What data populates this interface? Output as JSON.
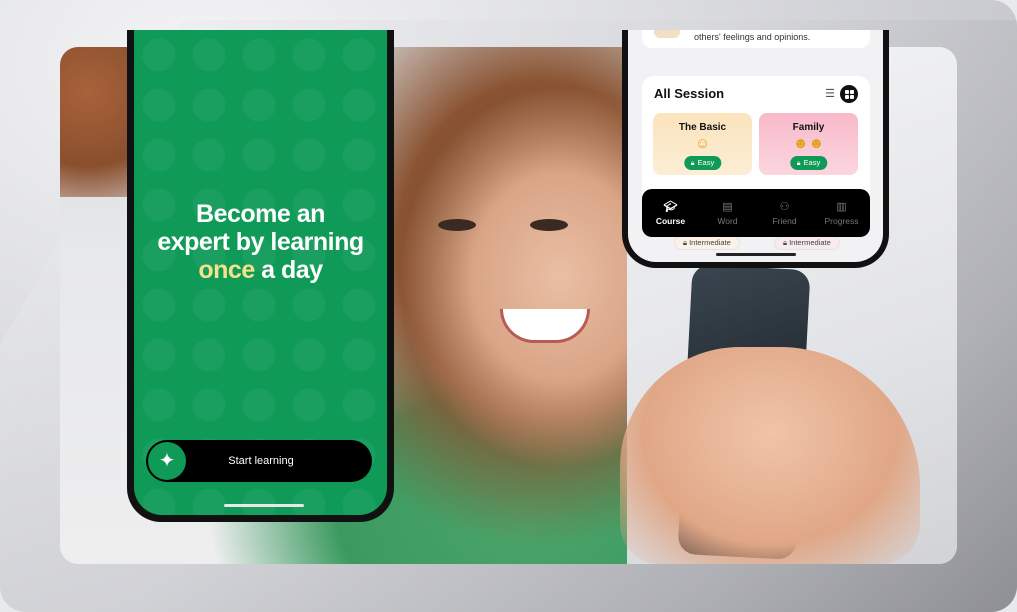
{
  "hero": {
    "line1": "Become an",
    "line2": "expert by learning",
    "accent": "once",
    "line3_rest": " a day",
    "accent_color": "#f4e28a",
    "brand_color": "#0f9a58"
  },
  "start_button": {
    "label": "Start learning",
    "icon": "sparkle-icon"
  },
  "right_phone": {
    "snippet_text": "others' feelings and opinions.",
    "section_title": "All Session",
    "view_icons": [
      "list-view-icon",
      "grid-view-icon"
    ],
    "cards": [
      {
        "title": "The Basic",
        "emoji": "smiling-face-icon",
        "level": "Easy"
      },
      {
        "title": "Family",
        "emoji": "family-icon",
        "level": "Easy"
      }
    ],
    "tabs": [
      {
        "label": "Course",
        "icon": "graduation-cap-icon",
        "active": true
      },
      {
        "label": "Word",
        "icon": "book-icon",
        "active": false
      },
      {
        "label": "Friend",
        "icon": "person-icon",
        "active": false
      },
      {
        "label": "Progress",
        "icon": "chart-icon",
        "active": false
      }
    ],
    "next_levels": [
      "Intermediate",
      "Intermediate"
    ]
  }
}
